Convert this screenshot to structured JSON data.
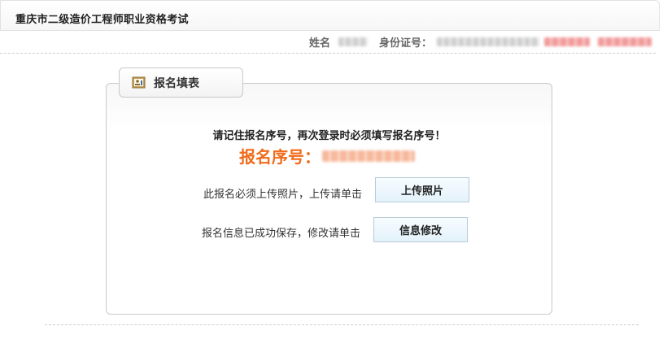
{
  "header": {
    "title": "重庆市二级造价工程师职业资格考试"
  },
  "user": {
    "name_label": "姓名",
    "id_label": "身份证号："
  },
  "panel": {
    "tab_label": "报名填表",
    "remember_note": "请记住报名序号，再次登录时必须填写报名序号！",
    "reg_number_label": "报名序号：",
    "upload_prompt": "此报名必须上传照片，上传请单击",
    "upload_button": "上传照片",
    "modify_prompt": "报名信息已成功保存，修改请单击",
    "modify_button": "信息修改"
  },
  "colors": {
    "accent_orange": "#f06b1a",
    "button_bg": "#e3f2fa",
    "button_border": "#b7cbd7"
  }
}
